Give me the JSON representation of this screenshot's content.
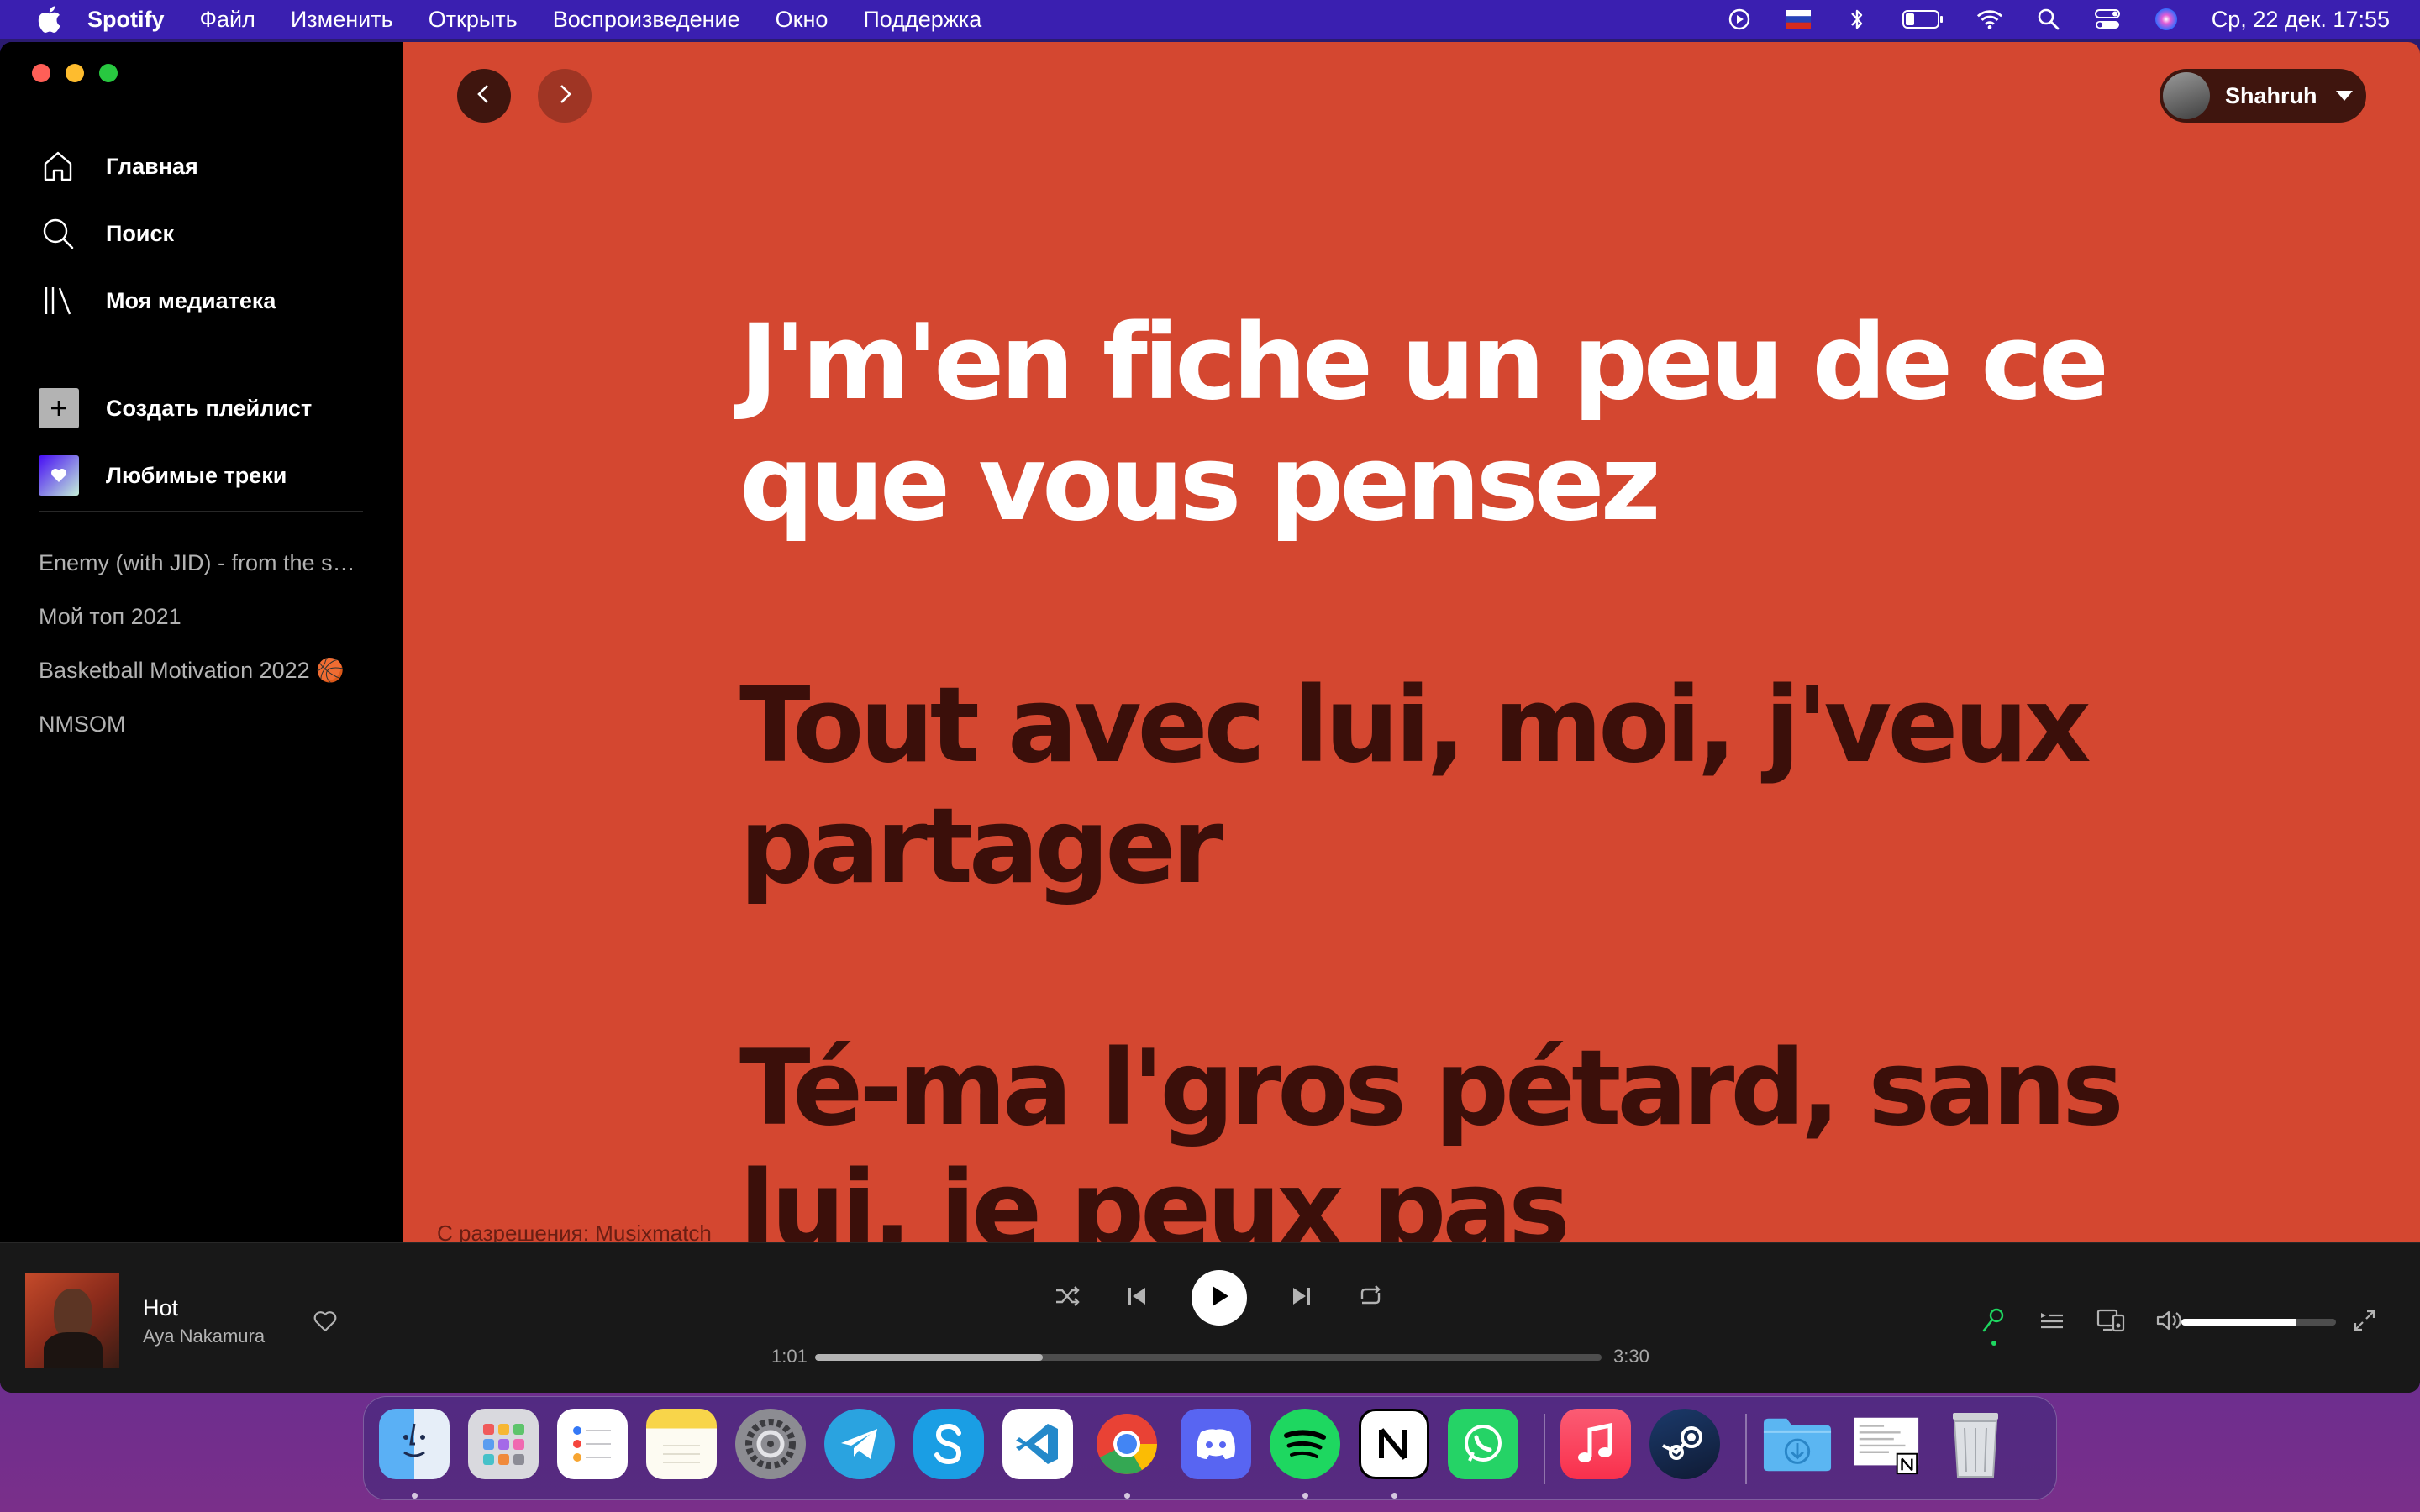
{
  "menubar": {
    "app_name": "Spotify",
    "menus": [
      "Файл",
      "Изменить",
      "Открыть",
      "Воспроизведение",
      "Окно",
      "Поддержка"
    ],
    "clock": "Ср, 22 дек.  17:55",
    "tray_icons": [
      "play-circle-icon",
      "russian-flag-icon",
      "bluetooth-icon",
      "battery-icon",
      "wifi-icon",
      "spotlight-search-icon",
      "control-center-icon",
      "siri-icon"
    ]
  },
  "sidebar": {
    "nav": [
      {
        "label": "Главная",
        "icon": "home-icon"
      },
      {
        "label": "Поиск",
        "icon": "search-icon"
      },
      {
        "label": "Моя медиатека",
        "icon": "library-icon"
      }
    ],
    "actions": [
      {
        "label": "Создать плейлист",
        "icon": "plus-icon"
      },
      {
        "label": "Любимые треки",
        "icon": "heart-icon"
      }
    ],
    "playlists": [
      "Enemy (with JID) - from the series Arcane League of Legends",
      "Мой топ 2021",
      "Basketball Motivation 2022 🏀",
      "NMSOM"
    ]
  },
  "header": {
    "user_name": "Shahruh"
  },
  "lyrics": {
    "lines": [
      {
        "text": "J'm'en fiche un peu de ce que vous pensez",
        "state": "current"
      },
      {
        "text": "Tout avec lui, moi, j'veux partager",
        "state": "upcoming"
      },
      {
        "text": "Té-ma l'gros pétard, sans lui, je peux pas",
        "state": "upcoming"
      }
    ],
    "credit": "С разрешения: Musixmatch",
    "background_color": "#d44730"
  },
  "player": {
    "track_title": "Hot",
    "artist": "Aya Nakamura",
    "elapsed": "1:01",
    "duration": "3:30",
    "progress_fraction": 0.29,
    "volume_fraction": 0.74,
    "accent_color": "#1ed760"
  },
  "dock": {
    "apps": [
      "Finder",
      "Launchpad",
      "Reminders",
      "Notes",
      "System Preferences",
      "Telegram",
      "Skype",
      "Visual Studio Code",
      "Google Chrome",
      "Discord",
      "Spotify",
      "Notion",
      "WhatsApp",
      "Music",
      "Steam",
      "Downloads",
      "Recent Document",
      "Trash"
    ]
  }
}
